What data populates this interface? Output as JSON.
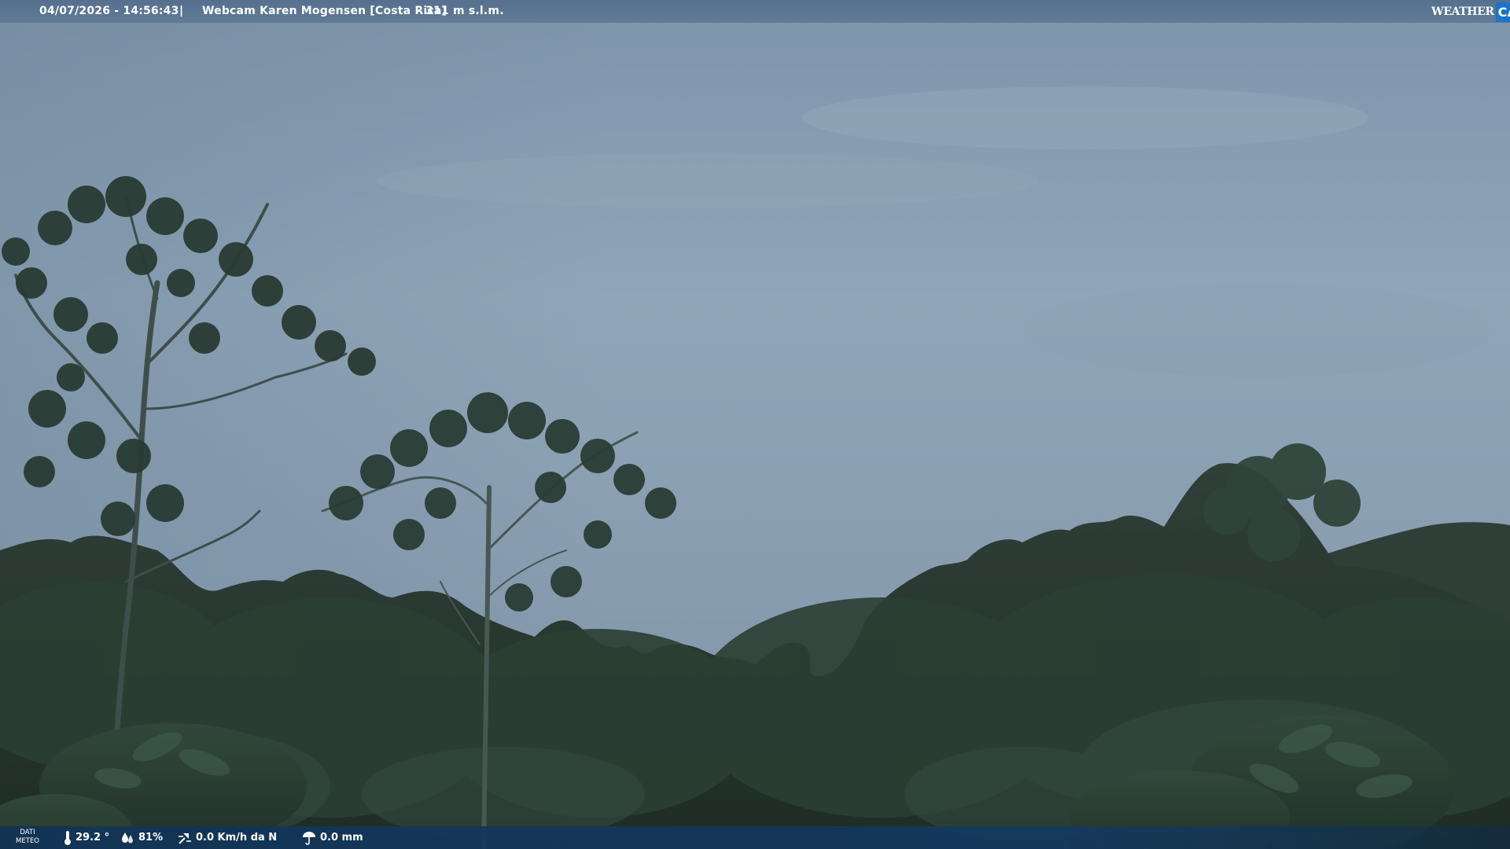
{
  "overlay_top": {
    "timestamp": "04/07/2026 - 14:56:43",
    "separator": "|",
    "camera_title": "Webcam Karen Mogensen [Costa Rica]",
    "elevation": "- 311 m s.l.m."
  },
  "logo": {
    "left_text": "WEATHER",
    "right_text": "CAM",
    "accent_color": "#1c73c8"
  },
  "overlay_bottom": {
    "label_line1": "DATI",
    "label_line2": "METEO",
    "temperature": "29.2 °",
    "humidity": "81%",
    "wind": "0.0 Km/h da N",
    "rain": "0.0 mm",
    "icons": [
      "thermometer-icon",
      "humidity-drops-icon",
      "wind-icon",
      "rain-icon"
    ]
  },
  "scene": {
    "subject": "overcast sky over tropical forest",
    "sky_color": "#8ea3b6",
    "foliage_color": "#1f2e22"
  }
}
